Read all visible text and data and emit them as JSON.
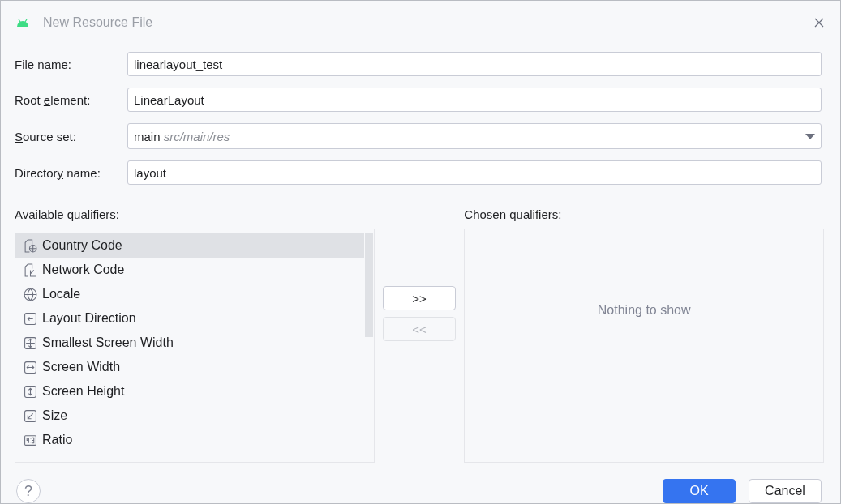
{
  "window": {
    "title": "New Resource File"
  },
  "fields": [
    {
      "label": {
        "key": "F",
        "after": "ile name:"
      },
      "value": "linearlayout_test",
      "kind": "text"
    },
    {
      "label": {
        "before": "Root ",
        "key": "e",
        "after": "lement:"
      },
      "value": "LinearLayout",
      "kind": "text"
    },
    {
      "label": {
        "key": "S",
        "after": "ource set:"
      },
      "value": "main",
      "hint": "src/main/res",
      "kind": "dropdown"
    },
    {
      "label": {
        "before": "Director",
        "key": "y",
        "after": " name:"
      },
      "value": "layout",
      "kind": "text"
    }
  ],
  "available": {
    "label": {
      "before": "A",
      "key": "v",
      "after": "ailable qualifiers:"
    },
    "items": [
      {
        "label": "Country Code",
        "selected": true
      },
      {
        "label": "Network Code",
        "selected": false
      },
      {
        "label": "Locale",
        "selected": false
      },
      {
        "label": "Layout Direction",
        "selected": false
      },
      {
        "label": "Smallest Screen Width",
        "selected": false
      },
      {
        "label": "Screen Width",
        "selected": false
      },
      {
        "label": "Screen Height",
        "selected": false
      },
      {
        "label": "Size",
        "selected": false
      },
      {
        "label": "Ratio",
        "selected": false
      }
    ]
  },
  "move_buttons": [
    {
      "label": ">>",
      "disabled": false
    },
    {
      "label": "<<",
      "disabled": true
    }
  ],
  "chosen": {
    "label": {
      "before": "C",
      "key": "h",
      "after": "osen qualifiers:"
    },
    "empty_text": "Nothing to show"
  },
  "help": "?",
  "buttons": [
    {
      "label": "OK",
      "kind": "primary"
    },
    {
      "label": "Cancel",
      "kind": "secondary"
    }
  ]
}
